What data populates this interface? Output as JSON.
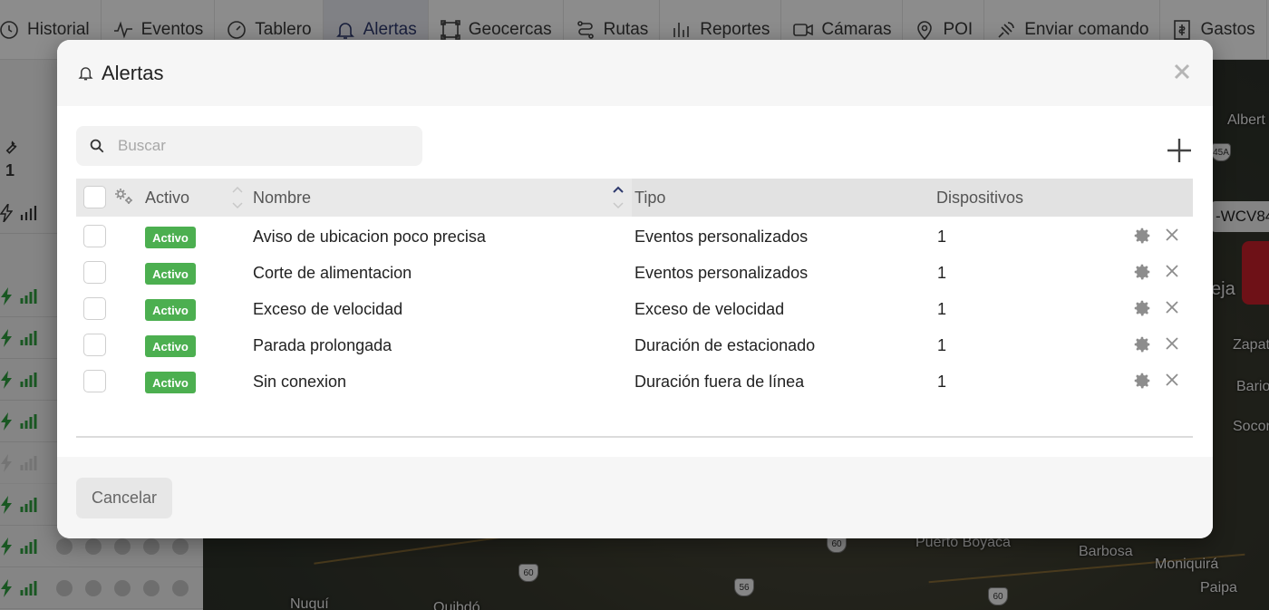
{
  "nav": {
    "items": [
      {
        "label": "Historial",
        "icon": "history-icon"
      },
      {
        "label": "Eventos",
        "icon": "pulse-icon"
      },
      {
        "label": "Tablero",
        "icon": "gauge-icon"
      },
      {
        "label": "Alertas",
        "icon": "bell-icon",
        "active": true
      },
      {
        "label": "Geocercas",
        "icon": "geofence-icon"
      },
      {
        "label": "Rutas",
        "icon": "route-icon"
      },
      {
        "label": "Reportes",
        "icon": "bar-chart-icon"
      },
      {
        "label": "Cámaras",
        "icon": "camera-icon"
      },
      {
        "label": "POI",
        "icon": "pin-icon"
      },
      {
        "label": "Enviar comando",
        "icon": "satellite-icon"
      },
      {
        "label": "Gastos",
        "icon": "invoice-icon"
      }
    ]
  },
  "sidebar": {
    "tool_count": "1"
  },
  "map": {
    "labels": [
      "Albert",
      "Zapat",
      "Bario",
      "Socon",
      "Puerto Boyaca",
      "Barbosa",
      "Moniquirá",
      "Paipa",
      "Nuquí",
      "Quibdó",
      "eja"
    ],
    "shields": [
      "45A",
      "60",
      "60",
      "56",
      "60"
    ],
    "vehicle_label": "-WCV84"
  },
  "modal": {
    "title": "Alertas",
    "search_placeholder": "Buscar",
    "columns": {
      "activo": "Activo",
      "nombre": "Nombre",
      "tipo": "Tipo",
      "dispositivos": "Dispositivos"
    },
    "rows": [
      {
        "status": "Activo",
        "nombre": "Aviso de ubicacion poco precisa",
        "tipo": "Eventos personalizados",
        "dispositivos": "1"
      },
      {
        "status": "Activo",
        "nombre": "Corte de alimentacion",
        "tipo": "Eventos personalizados",
        "dispositivos": "1"
      },
      {
        "status": "Activo",
        "nombre": "Exceso de velocidad",
        "tipo": "Exceso de velocidad",
        "dispositivos": "1"
      },
      {
        "status": "Activo",
        "nombre": "Parada prolongada",
        "tipo": "Duración de estacionado",
        "dispositivos": "1"
      },
      {
        "status": "Activo",
        "nombre": "Sin conexion",
        "tipo": "Duración fuera de línea",
        "dispositivos": "1"
      }
    ],
    "cancel_label": "Cancelar"
  },
  "colors": {
    "active_badge": "#4caf50",
    "active_nav": "#2f3a6e",
    "signal_green": "#2e9e3e"
  }
}
